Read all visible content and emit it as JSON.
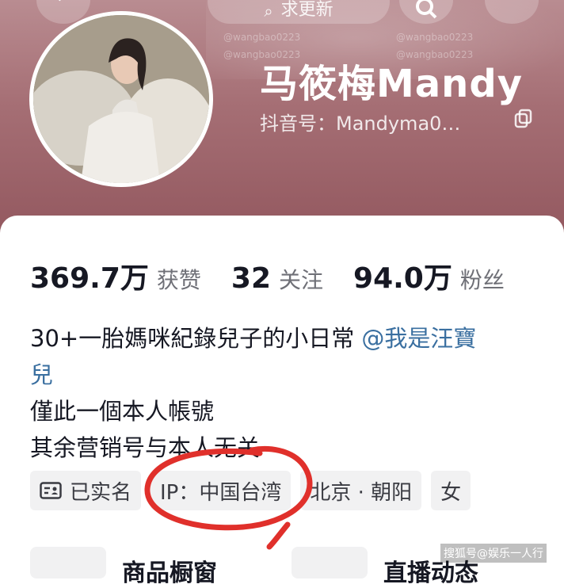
{
  "header": {
    "search_label": "求更新",
    "watermarks": [
      "@wangbao0223",
      "@wangbao0223",
      "@wangbao0223",
      "@wangbao0223"
    ]
  },
  "profile": {
    "name": "马筱梅Mandy",
    "douyin_id": "抖音号：Mandyma0…"
  },
  "stats": [
    {
      "value": "369.7万",
      "label": "获赞"
    },
    {
      "value": "32",
      "label": "关注"
    },
    {
      "value": "94.0万",
      "label": "粉丝"
    }
  ],
  "bio": {
    "line1_text": "30+一胎媽咪紀錄兒子的小日常 ",
    "line1_mention": "@我是汪寶",
    "line2_mention": "兒",
    "line3": "僅此一個本人帳號",
    "line4": "其余营销号与本人无关"
  },
  "tags": {
    "verified": "已实名",
    "ip": "IP：中国台湾",
    "location": "北京 · 朝阳",
    "gender": "女"
  },
  "bottom": {
    "left_label": "商品橱窗",
    "right_label": "直播动态"
  },
  "footer_watermark": "搜狐号@娱乐一人行",
  "colors": {
    "header_bg": "#a56e74",
    "mention": "#3a6fa0",
    "annotation_circle": "#e0302b"
  }
}
